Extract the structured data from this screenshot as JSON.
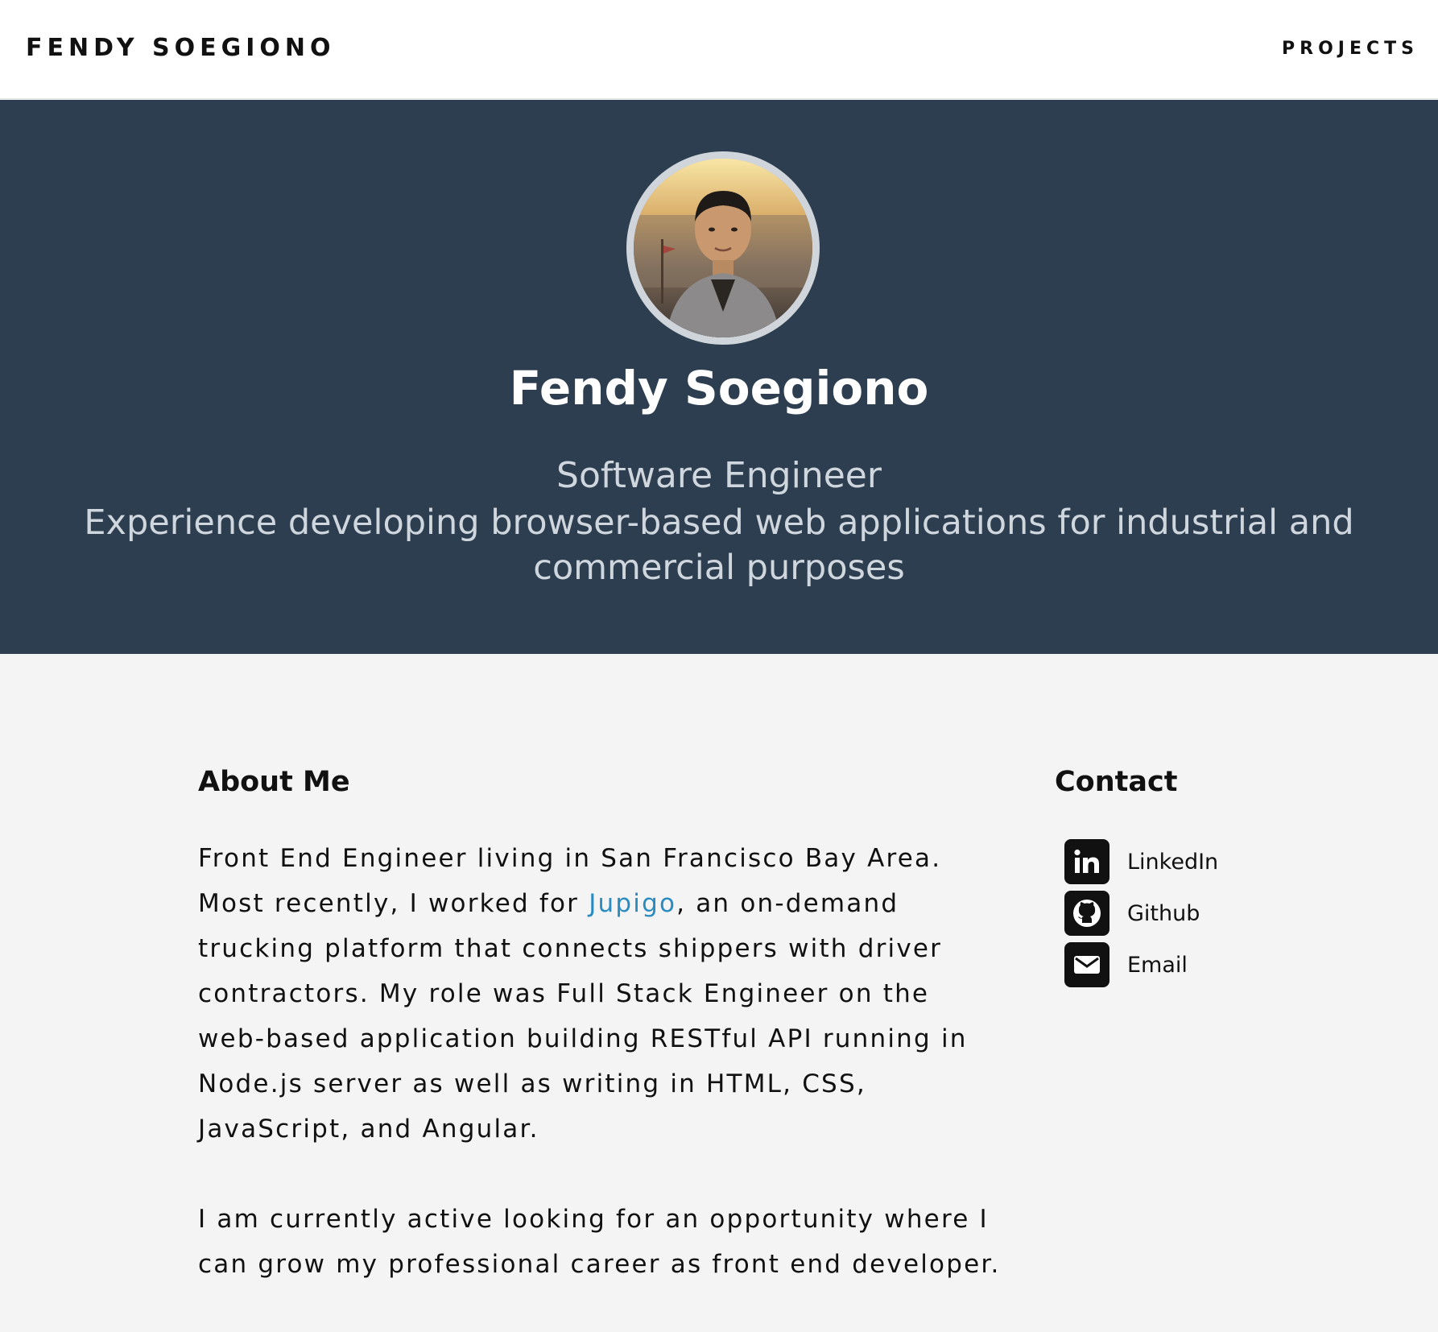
{
  "nav": {
    "brand": "FENDY SOEGIONO",
    "projects": "PROJECTS"
  },
  "hero": {
    "avatar_icon": "profile-photo",
    "name": "Fendy Soegiono",
    "title": "Software Engineer",
    "description": "Experience developing browser-based web applications for industrial and commercial purposes",
    "background_color": "#2c3e4f"
  },
  "about": {
    "heading": "About Me",
    "p1_before": "Front End Engineer living in San Francisco Bay Area. Most recently, I worked for ",
    "p1_link": "Jupigo",
    "p1_after": ", an on-demand trucking platform that connects shippers with driver contractors. My role was Full Stack Engineer on the web-based application building RESTful API running in Node.js server as well as writing in HTML, CSS, JavaScript, and Angular.",
    "p2": "I am currently active looking for an opportunity where I can grow my professional career as front end developer.",
    "link_color": "#2a8bc0"
  },
  "contact": {
    "heading": "Contact",
    "items": [
      {
        "label": "LinkedIn",
        "icon": "linkedin-icon"
      },
      {
        "label": "Github",
        "icon": "github-icon"
      },
      {
        "label": "Email",
        "icon": "email-icon"
      }
    ]
  }
}
